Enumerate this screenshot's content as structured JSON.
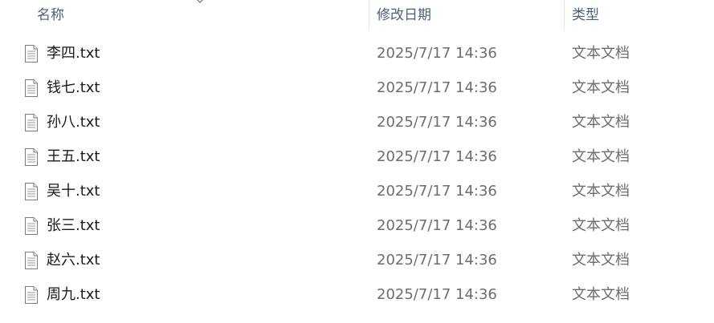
{
  "columns": {
    "name": "名称",
    "date": "修改日期",
    "type": "类型"
  },
  "files": [
    {
      "name": "李四.txt",
      "date": "2025/7/17 14:36",
      "type": "文本文档"
    },
    {
      "name": "钱七.txt",
      "date": "2025/7/17 14:36",
      "type": "文本文档"
    },
    {
      "name": "孙八.txt",
      "date": "2025/7/17 14:36",
      "type": "文本文档"
    },
    {
      "name": "王五.txt",
      "date": "2025/7/17 14:36",
      "type": "文本文档"
    },
    {
      "name": "吴十.txt",
      "date": "2025/7/17 14:36",
      "type": "文本文档"
    },
    {
      "name": "张三.txt",
      "date": "2025/7/17 14:36",
      "type": "文本文档"
    },
    {
      "name": "赵六.txt",
      "date": "2025/7/17 14:36",
      "type": "文本文档"
    },
    {
      "name": "周九.txt",
      "date": "2025/7/17 14:36",
      "type": "文本文档"
    }
  ],
  "icons": {
    "file": "text-file-icon",
    "sort": "sort-caret-icon"
  },
  "colors": {
    "header_text": "#4c607a",
    "name_text": "#1a1a1a",
    "meta_text": "#6d6d6d"
  }
}
